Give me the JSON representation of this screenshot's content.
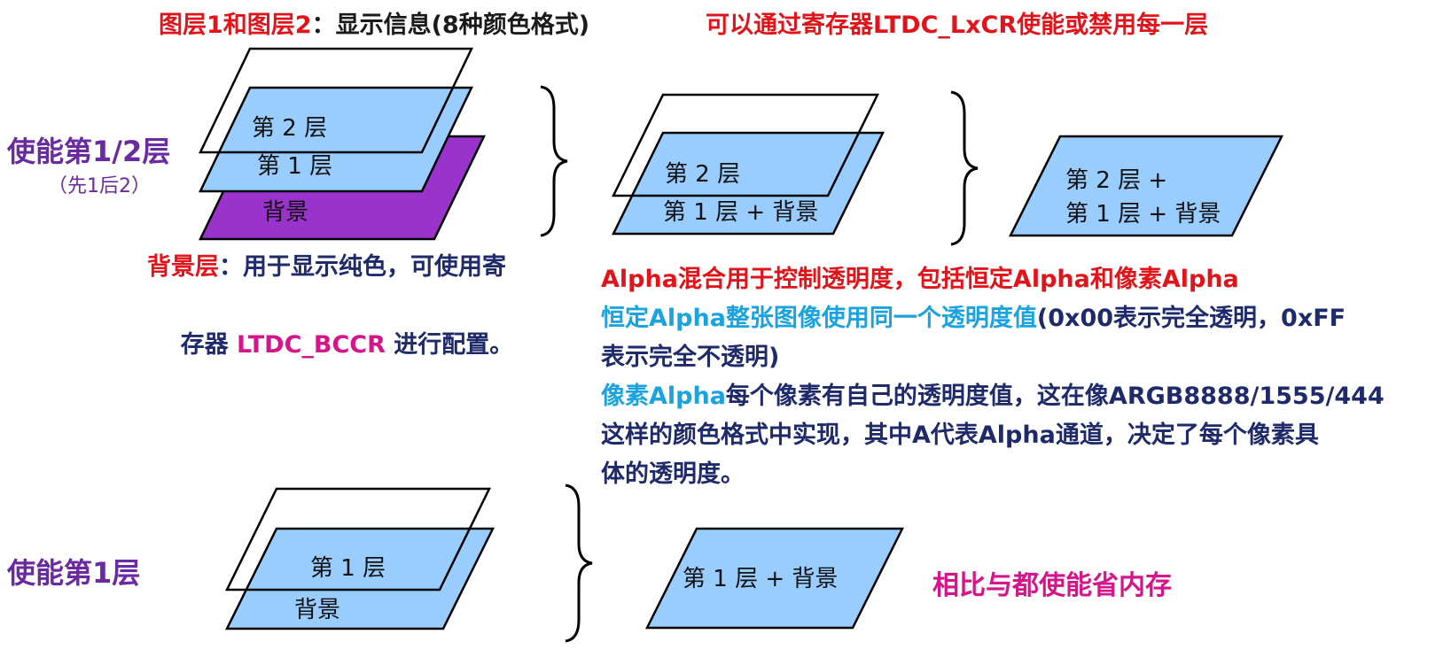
{
  "colors": {
    "layer_fill": "#99ccff",
    "background_fill": "#9933cc",
    "outline": "#000000",
    "red": "#e0141b",
    "magenta": "#d4168a",
    "cyan": "#1aa3de",
    "navy": "#1f2a6b",
    "purple": "#6b2ba0"
  },
  "header": {
    "layers_label": "图层1和图层2",
    "layers_desc": "：显示信息(8种颜色格式)",
    "register_note": "可以通过寄存器LTDC_LxCR使能或禁用每一层"
  },
  "section_both": {
    "title": "使能第1/2层",
    "subtitle": "（先1后2）",
    "stack": {
      "layer2": "第 2 层",
      "layer1": "第 1 层",
      "background": "背景"
    },
    "step1": {
      "layer2": "第 2 层",
      "combined": "第 1 层 + 背景"
    },
    "step2": {
      "line1": "第 2 层 +",
      "line2": "第 1 层 + 背景"
    }
  },
  "background_note": {
    "label": "背景层",
    "text_a": "：用于显示纯色，可使用寄",
    "text_b": "存器 ",
    "register": "LTDC_BCCR",
    "text_c": " 进行配置。"
  },
  "alpha_notes": {
    "line1": "Alpha混合用于控制透明度，包括恒定Alpha和像素Alpha",
    "constant_label": "恒定Alpha整张图像使用同一个透明度值",
    "constant_text_a": "(0x00表示完全透明，0xFF",
    "constant_text_b": "表示完全不透明)",
    "pixel_label": "像素Alpha",
    "pixel_text_a": "每个像素有自己的透明度值，这在像ARGB8888/1555/444",
    "pixel_text_b": "这样的颜色格式中实现，其中A代表Alpha通道，决定了每个像素具",
    "pixel_text_c": "体的透明度。"
  },
  "section_one": {
    "title": "使能第1层",
    "stack": {
      "layer1": "第 1 层",
      "background": "背景"
    },
    "result": "第 1 层 +  背景",
    "note": "相比与都使能省内存"
  }
}
